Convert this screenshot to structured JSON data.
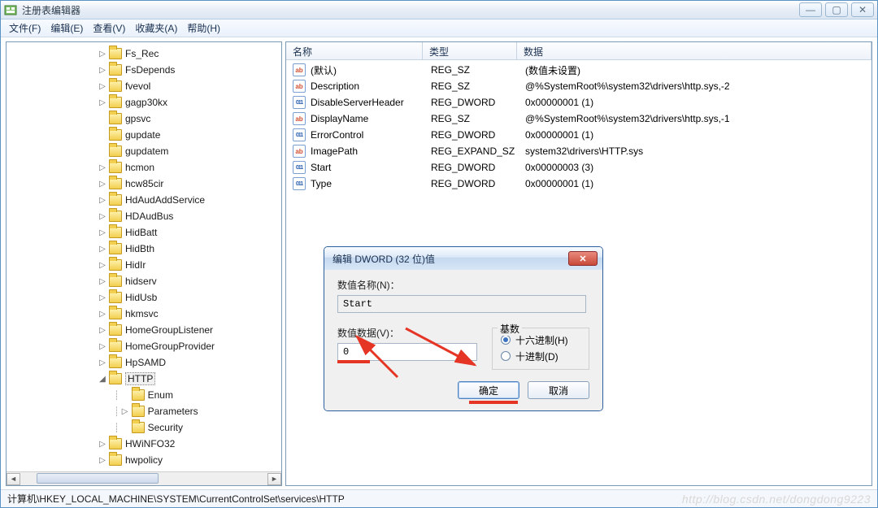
{
  "window": {
    "title": "注册表编辑器"
  },
  "menu": {
    "file": "文件(F)",
    "edit": "编辑(E)",
    "view": "查看(V)",
    "fav": "收藏夹(A)",
    "help": "帮助(H)"
  },
  "tree": {
    "items": [
      {
        "label": "Fs_Rec",
        "exp": "▷"
      },
      {
        "label": "FsDepends",
        "exp": "▷"
      },
      {
        "label": "fvevol",
        "exp": "▷"
      },
      {
        "label": "gagp30kx",
        "exp": "▷"
      },
      {
        "label": "gpsvc",
        "exp": ""
      },
      {
        "label": "gupdate",
        "exp": ""
      },
      {
        "label": "gupdatem",
        "exp": ""
      },
      {
        "label": "hcmon",
        "exp": "▷"
      },
      {
        "label": "hcw85cir",
        "exp": "▷"
      },
      {
        "label": "HdAudAddService",
        "exp": "▷"
      },
      {
        "label": "HDAudBus",
        "exp": "▷"
      },
      {
        "label": "HidBatt",
        "exp": "▷"
      },
      {
        "label": "HidBth",
        "exp": "▷"
      },
      {
        "label": "HidIr",
        "exp": "▷"
      },
      {
        "label": "hidserv",
        "exp": "▷"
      },
      {
        "label": "HidUsb",
        "exp": "▷"
      },
      {
        "label": "hkmsvc",
        "exp": "▷"
      },
      {
        "label": "HomeGroupListener",
        "exp": "▷"
      },
      {
        "label": "HomeGroupProvider",
        "exp": "▷"
      },
      {
        "label": "HpSAMD",
        "exp": "▷"
      },
      {
        "label": "HTTP",
        "exp": "◢",
        "selected": true
      },
      {
        "label": "Enum",
        "exp": "",
        "sub": true
      },
      {
        "label": "Parameters",
        "exp": "▷",
        "sub": true
      },
      {
        "label": "Security",
        "exp": "",
        "sub": true
      },
      {
        "label": "HWiNFO32",
        "exp": "▷"
      },
      {
        "label": "hwpolicy",
        "exp": "▷"
      }
    ]
  },
  "list": {
    "headers": {
      "name": "名称",
      "type": "类型",
      "data": "数据"
    },
    "rows": [
      {
        "icon": "sz",
        "name": "(默认)",
        "type": "REG_SZ",
        "data": "(数值未设置)"
      },
      {
        "icon": "sz",
        "name": "Description",
        "type": "REG_SZ",
        "data": "@%SystemRoot%\\system32\\drivers\\http.sys,-2"
      },
      {
        "icon": "dw",
        "name": "DisableServerHeader",
        "type": "REG_DWORD",
        "data": "0x00000001 (1)"
      },
      {
        "icon": "sz",
        "name": "DisplayName",
        "type": "REG_SZ",
        "data": "@%SystemRoot%\\system32\\drivers\\http.sys,-1"
      },
      {
        "icon": "dw",
        "name": "ErrorControl",
        "type": "REG_DWORD",
        "data": "0x00000001 (1)"
      },
      {
        "icon": "sz",
        "name": "ImagePath",
        "type": "REG_EXPAND_SZ",
        "data": "system32\\drivers\\HTTP.sys"
      },
      {
        "icon": "dw",
        "name": "Start",
        "type": "REG_DWORD",
        "data": "0x00000003 (3)"
      },
      {
        "icon": "dw",
        "name": "Type",
        "type": "REG_DWORD",
        "data": "0x00000001 (1)"
      }
    ]
  },
  "dialog": {
    "title": "编辑 DWORD (32 位)值",
    "name_label": "数值名称(N)：",
    "name_value": "Start",
    "data_label": "数值数据(V)：",
    "data_value": "0",
    "base_label": "基数",
    "hex": "十六进制(H)",
    "dec": "十进制(D)",
    "ok": "确定",
    "cancel": "取消"
  },
  "statusbar": {
    "path": "计算机\\HKEY_LOCAL_MACHINE\\SYSTEM\\CurrentControlSet\\services\\HTTP"
  },
  "watermark": "http://blog.csdn.net/dongdong9223"
}
